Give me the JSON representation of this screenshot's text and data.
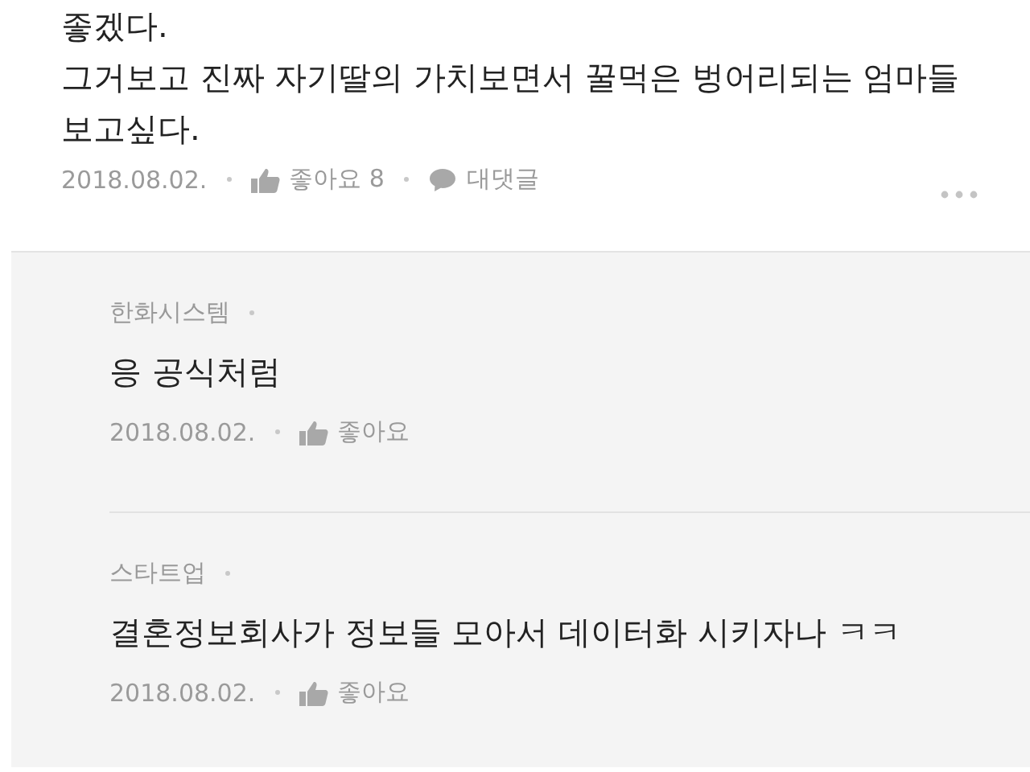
{
  "comment": {
    "body_lines": [
      "좋겠다.",
      "그거보고 진짜 자기딸의 가치보면서 꿀먹은 벙어리되는 엄마들",
      "보고싶다."
    ],
    "date": "2018.08.02.",
    "like_label": "좋아요 8",
    "reply_label": "대댓글"
  },
  "replies": [
    {
      "author": "한화시스템",
      "text": "응 공식처럼",
      "date": "2018.08.02.",
      "like_label": "좋아요"
    },
    {
      "author": "스타트업",
      "text": "결혼정보회사가 정보들 모아서 데이터화 시키자나 ㅋㅋ",
      "date": "2018.08.02.",
      "like_label": "좋아요"
    }
  ]
}
